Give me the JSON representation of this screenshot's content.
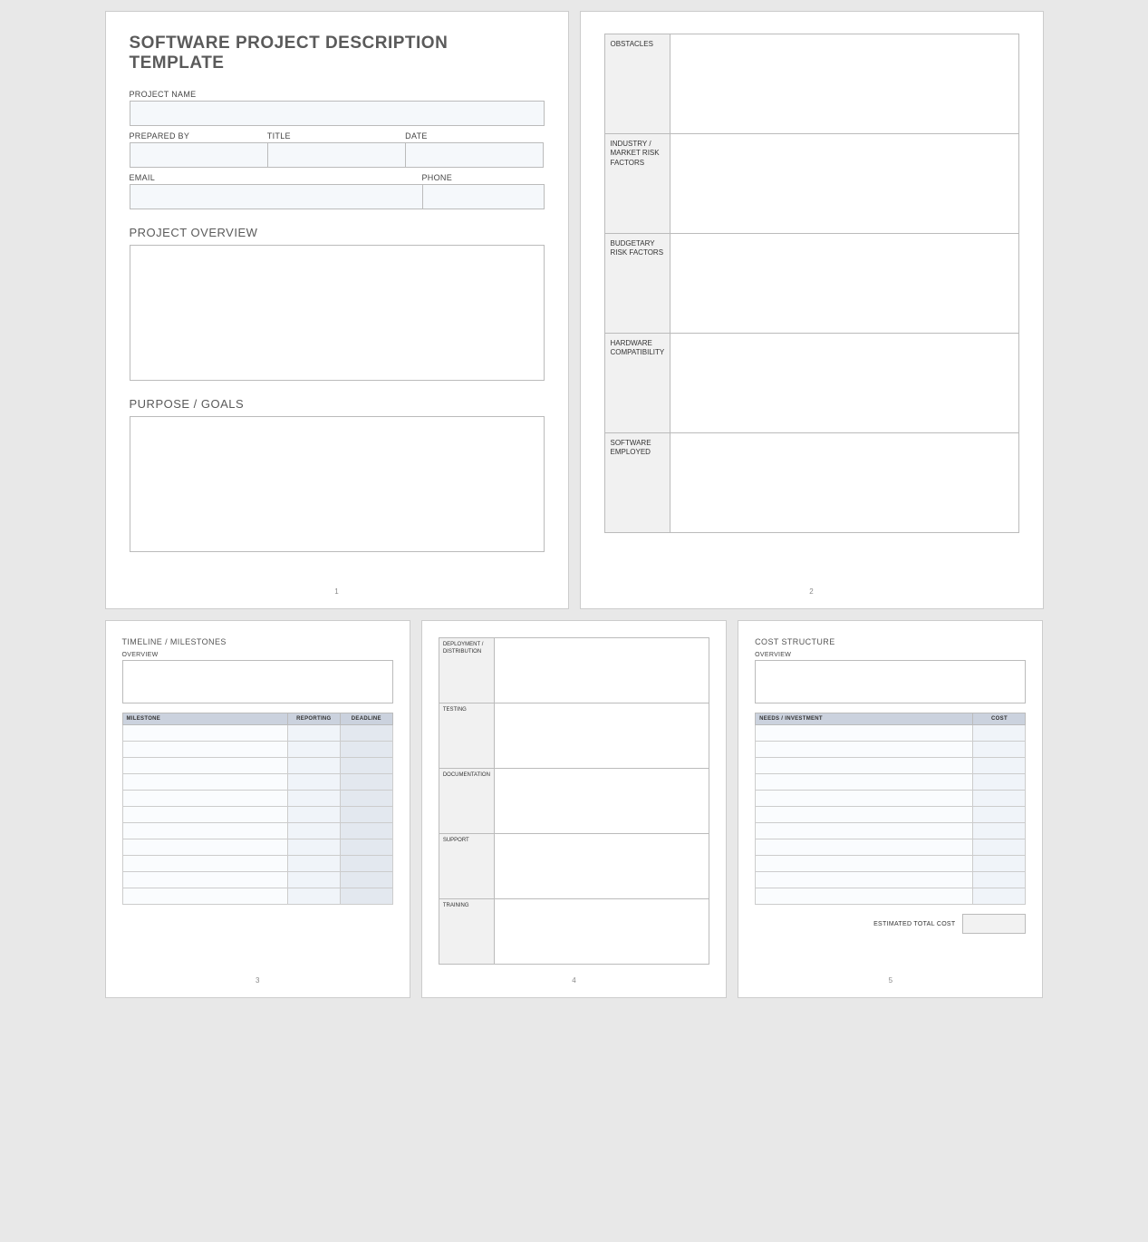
{
  "page1": {
    "title": "SOFTWARE PROJECT DESCRIPTION TEMPLATE",
    "labels": {
      "project_name": "PROJECT NAME",
      "prepared_by": "PREPARED BY",
      "title": "TITLE",
      "date": "DATE",
      "email": "EMAIL",
      "phone": "PHONE"
    },
    "sections": {
      "overview": "PROJECT OVERVIEW",
      "purpose": "PURPOSE / GOALS"
    },
    "num": "1"
  },
  "page2": {
    "rows": [
      "OBSTACLES",
      "INDUSTRY / MARKET RISK FACTORS",
      "BUDGETARY RISK FACTORS",
      "HARDWARE COMPATIBILITY",
      "SOFTWARE EMPLOYED"
    ],
    "num": "2"
  },
  "page3": {
    "heading": "TIMELINE / MILESTONES",
    "overview_label": "OVERVIEW",
    "cols": {
      "milestone": "MILESTONE",
      "reporting": "REPORTING",
      "deadline": "DEADLINE"
    },
    "row_count": 11,
    "num": "3"
  },
  "page4": {
    "rows": [
      "DEPLOYMENT / DISTRIBUTION",
      "TESTING",
      "DOCUMENTATION",
      "SUPPORT",
      "TRAINING"
    ],
    "num": "4"
  },
  "page5": {
    "heading": "COST STRUCTURE",
    "overview_label": "OVERVIEW",
    "cols": {
      "needs": "NEEDS / INVESTMENT",
      "cost": "COST"
    },
    "row_count": 11,
    "total_label": "ESTIMATED TOTAL COST",
    "num": "5"
  }
}
